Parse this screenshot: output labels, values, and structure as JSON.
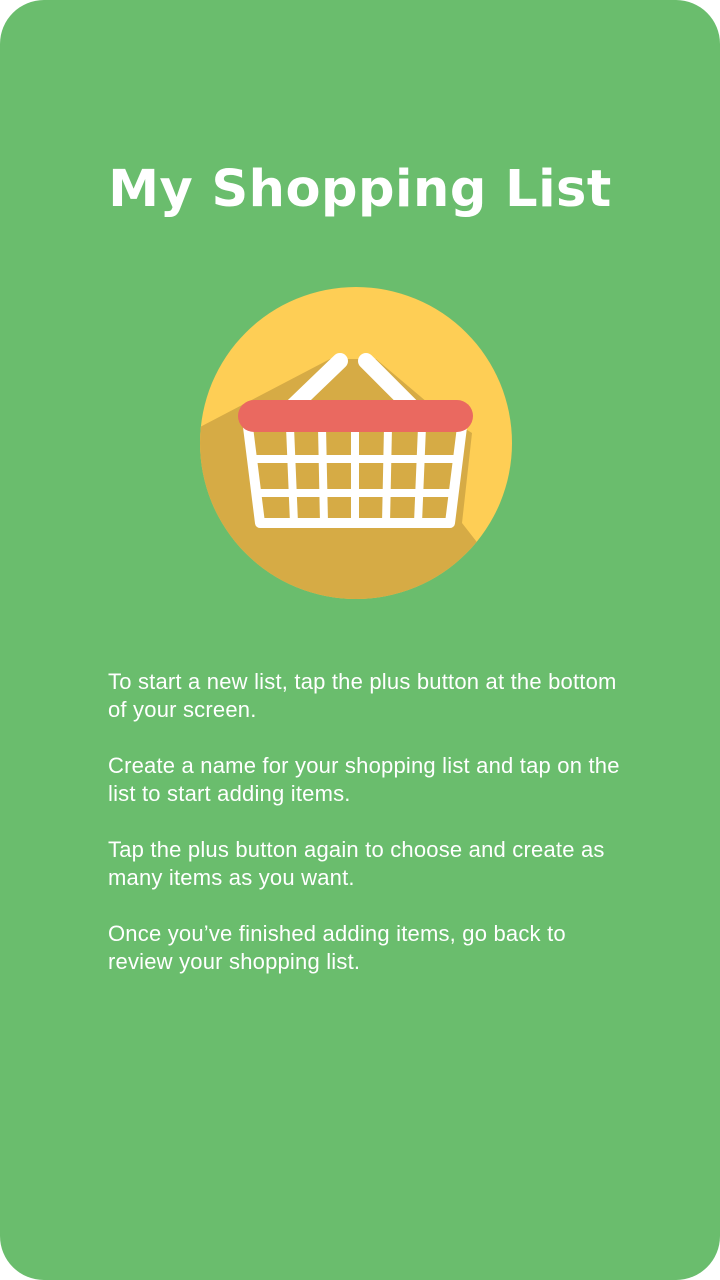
{
  "screen": {
    "background_color": "#6abd6d"
  },
  "header": {
    "title": "My Shopping List"
  },
  "illustration": {
    "icon": "shopping-basket-icon",
    "circle_color": "#fece55",
    "shadow_color": "#d6ab45",
    "handle_band_color": "#ea6960",
    "basket_color": "#ffffff"
  },
  "instructions": [
    "To start a new list, tap the plus button at the bottom of your screen.",
    "Create a name for your shopping list and tap on the list to start adding items.",
    "Tap the plus button again to choose and create as many items as you want.",
    "Once you’ve finished adding items, go back to review your shopping list."
  ]
}
